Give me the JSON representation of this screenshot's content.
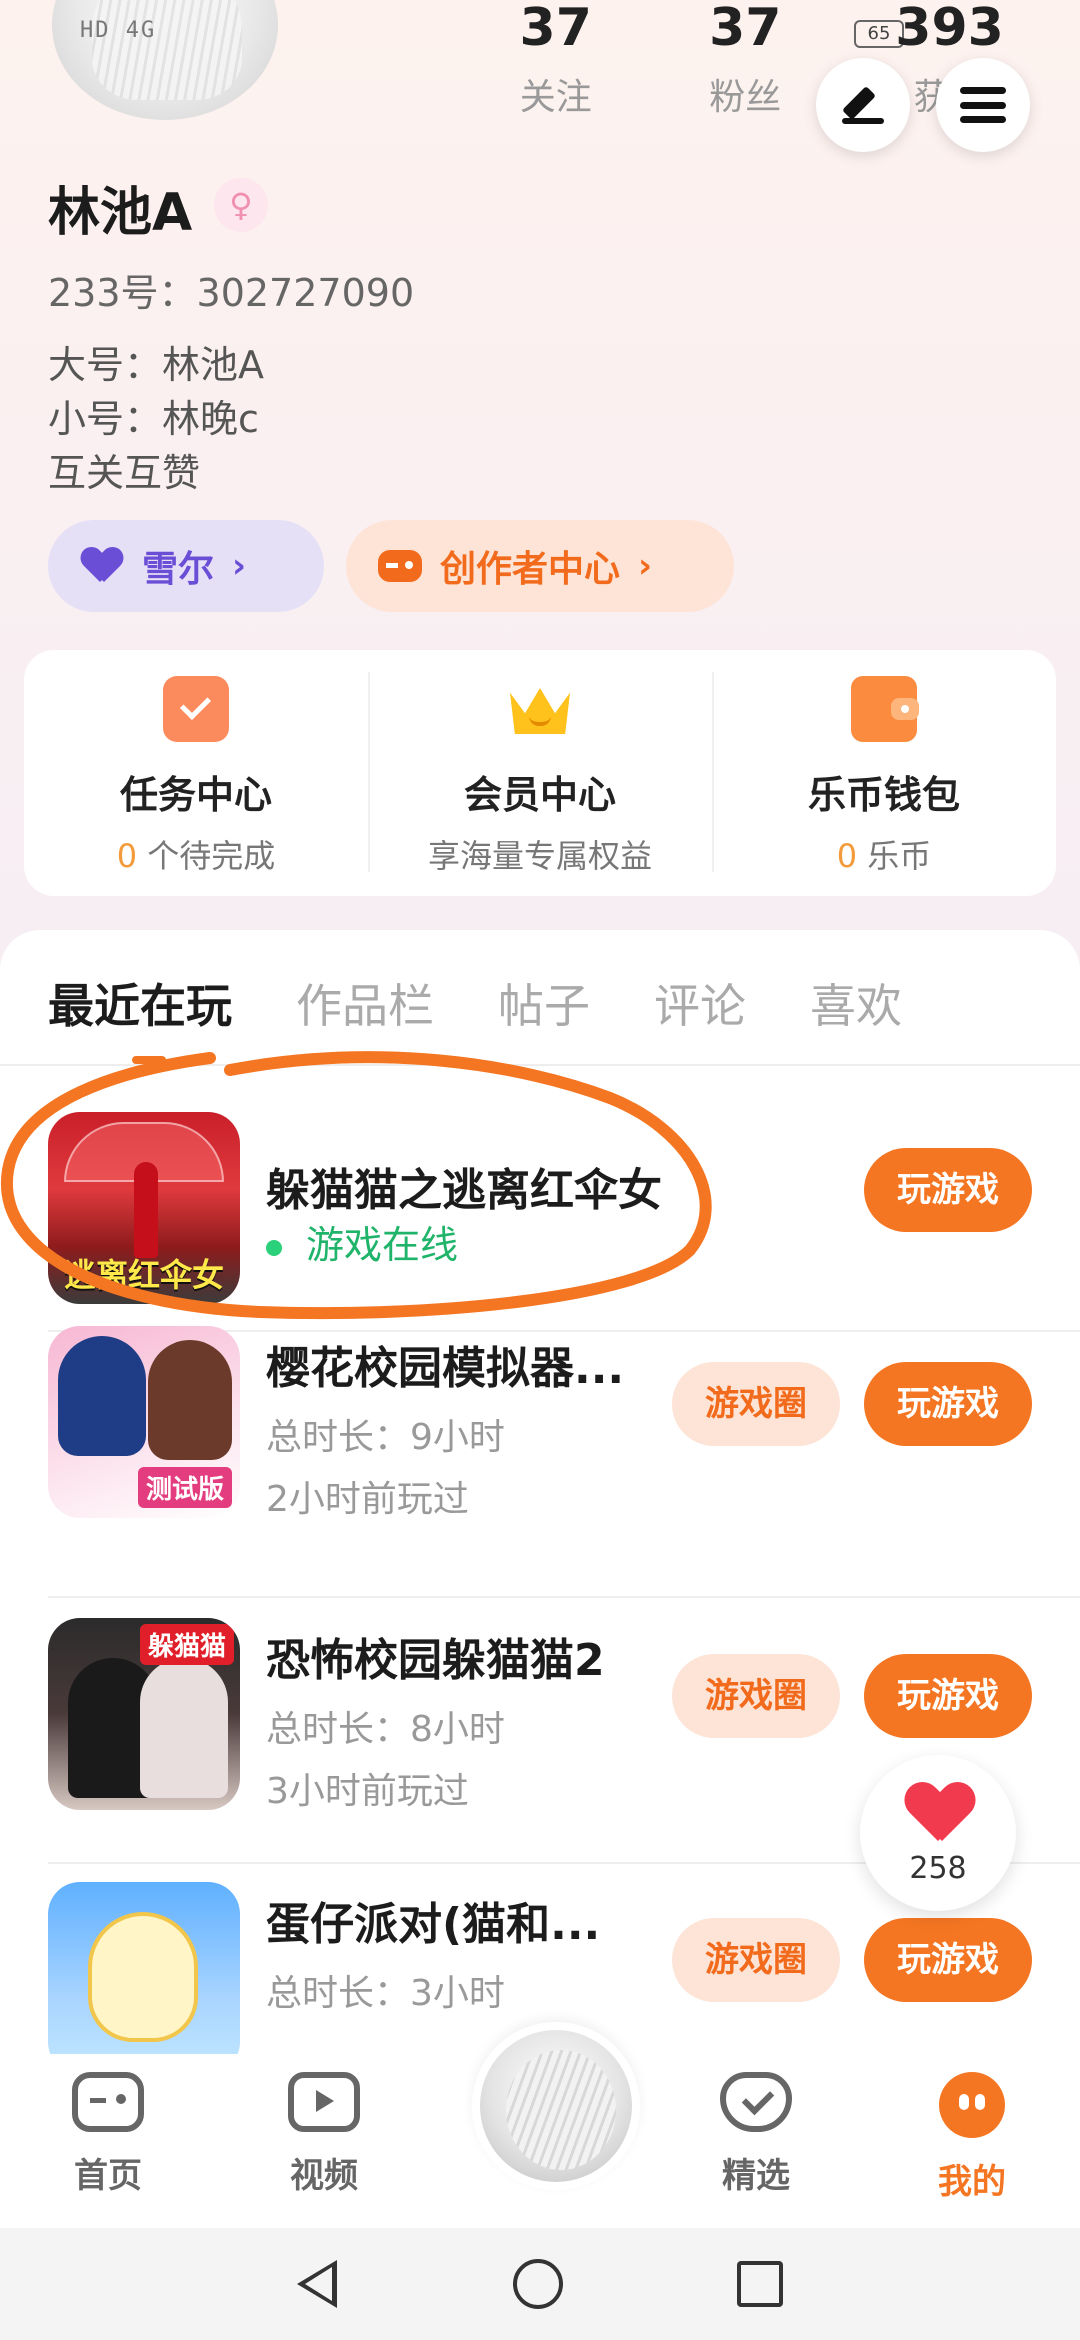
{
  "status": {
    "network": "HD 4G",
    "battery": "65"
  },
  "profile": {
    "stats": [
      {
        "num": "37",
        "label": "关注"
      },
      {
        "num": "37",
        "label": "粉丝"
      },
      {
        "num": "393",
        "label": "获赞"
      }
    ],
    "username": "林池A",
    "gender_icon": "female-icon",
    "uid": "233号：302727090",
    "bio": [
      "大号：林池A",
      "小号：林晚c",
      "互关互赞"
    ],
    "chips": [
      {
        "label": "雪尔",
        "icon": "heart-icon"
      },
      {
        "label": "创作者中心",
        "icon": "gamepad-icon"
      }
    ]
  },
  "services": [
    {
      "title": "任务中心",
      "highlight": "0",
      "sub": " 个待完成",
      "icon": "task-calendar-icon"
    },
    {
      "title": "会员中心",
      "highlight": "",
      "sub": "享海量专属权益",
      "icon": "crown-icon"
    },
    {
      "title": "乐币钱包",
      "highlight": "0",
      "sub": " 乐币",
      "icon": "wallet-icon"
    }
  ],
  "tabs": [
    "最近在玩",
    "作品栏",
    "帖子",
    "评论",
    "喜欢"
  ],
  "games": [
    {
      "name": "躲猫猫之逃离红伞女",
      "status": "游戏在线",
      "icon_caption": "逃离红伞女",
      "play": "玩游戏"
    },
    {
      "name": "樱花校园模拟器...",
      "duration": "总时长：9小时",
      "last_played": "2小时前玩过",
      "icon_caption": "测试版",
      "circle": "游戏圈",
      "play": "玩游戏"
    },
    {
      "name": "恐怖校园躲猫猫2",
      "duration": "总时长：8小时",
      "last_played": "3小时前玩过",
      "icon_caption": "躲猫猫",
      "circle": "游戏圈",
      "play": "玩游戏"
    },
    {
      "name": "蛋仔派对(猫和...",
      "duration": "总时长：3小时",
      "circle": "游戏圈",
      "play": "玩游戏"
    }
  ],
  "like_count": "258",
  "nav": [
    {
      "label": "首页",
      "icon": "gamepad-icon"
    },
    {
      "label": "视频",
      "icon": "video-play-icon"
    },
    {
      "label": "",
      "icon": "avatar"
    },
    {
      "label": "精选",
      "icon": "heart-shield-icon"
    },
    {
      "label": "我的",
      "icon": "face-icon"
    }
  ],
  "colors": {
    "accent": "#f57622",
    "online": "#1fb46a",
    "purple": "#6a4fd6"
  }
}
